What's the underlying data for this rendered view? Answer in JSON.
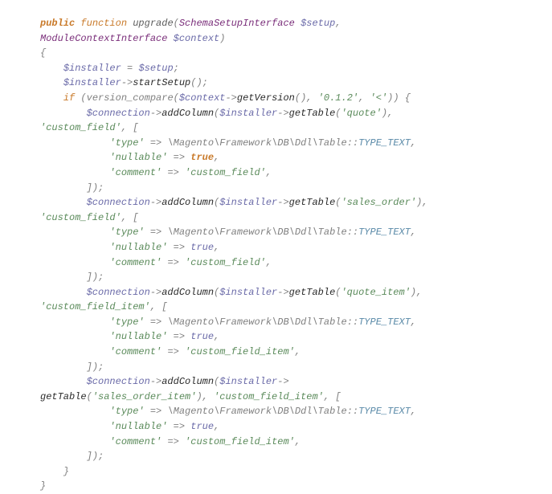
{
  "code": {
    "keywords": {
      "public": "public",
      "function": "function",
      "if": "if",
      "true": "true"
    },
    "function_name": "upgrade",
    "params": {
      "type1": "SchemaSetupInterface",
      "var1": "$setup",
      "type2": "ModuleContextInterface",
      "var2": "$context"
    },
    "vars": {
      "installer": "$installer",
      "setup": "$setup",
      "context": "$context",
      "connection": "$connection"
    },
    "methods": {
      "startSetup": "startSetup",
      "version_compare": "version_compare",
      "getVersion": "getVersion",
      "addColumn": "addColumn",
      "getTable": "getTable"
    },
    "strings": {
      "version": "'0.1.2'",
      "lt": "'<'",
      "quote": "'quote'",
      "custom_field": "'custom_field'",
      "sales_order": "'sales_order'",
      "quote_item": "'quote_item'",
      "custom_field_item": "'custom_field_item'",
      "sales_order_item": "'sales_order_item'",
      "type": "'type'",
      "nullable": "'nullable'",
      "comment": "'comment'"
    },
    "namespace": {
      "table_path": "\\Magento\\Framework\\DB\\Ddl\\Table",
      "type_text": "TYPE_TEXT"
    },
    "punct": {
      "open_brace": "{",
      "close_brace": "}",
      "open_paren": "(",
      "close_paren": ")",
      "open_bracket": "[",
      "close_bracket": "]",
      "semicolon": ";",
      "comma": ",",
      "eq": "=",
      "arrow": "->",
      "fat_arrow": "=>",
      "scope": "::"
    },
    "literals": {
      "true": "true"
    }
  }
}
